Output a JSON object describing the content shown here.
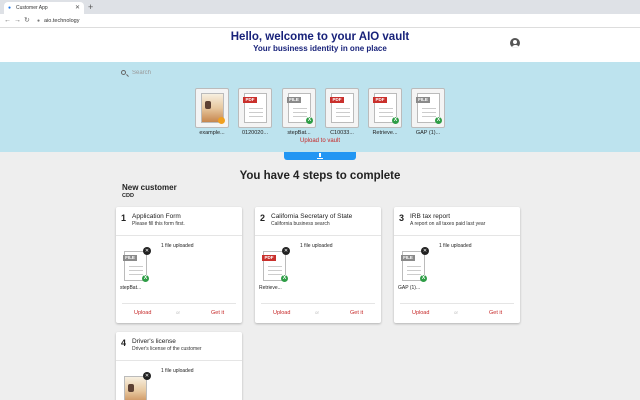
{
  "browser": {
    "tab_title": "Customer App",
    "url": "aio.technology"
  },
  "header": {
    "title": "Hello, welcome to your AIO vault",
    "subtitle": "Your business identity in one place"
  },
  "vault": {
    "search_placeholder": "Search",
    "files": [
      {
        "name": "example...",
        "type": "image"
      },
      {
        "name": "0120020...",
        "type": "pdf"
      },
      {
        "name": "stepBat...",
        "type": "file"
      },
      {
        "name": "C10033...",
        "type": "pdf"
      },
      {
        "name": "Retrieve...",
        "type": "pdf"
      },
      {
        "name": "GAP (1)...",
        "type": "file"
      }
    ],
    "upload_label": "Upload to vault"
  },
  "steps": {
    "title": "You have 4 steps to complete",
    "customer_name": "New customer",
    "customer_code": "CDD",
    "cards": [
      {
        "num": "1",
        "title": "Application Form",
        "desc": "Please fill this form first.",
        "status": "1 file uploaded",
        "file": "stepBat...",
        "file_type": "file",
        "upload": "Upload",
        "or": "or",
        "getit": "Get it"
      },
      {
        "num": "2",
        "title": "California Secretary of State",
        "desc": "California business search",
        "status": "1 file uploaded",
        "file": "Retrieve...",
        "file_type": "pdf",
        "upload": "Upload",
        "or": "or",
        "getit": "Get it"
      },
      {
        "num": "3",
        "title": "IRB tax report",
        "desc": "A report on all taxes paid last year",
        "status": "1 file uploaded",
        "file": "GAP (1)...",
        "file_type": "file",
        "upload": "Upload",
        "or": "or",
        "getit": "Get it"
      },
      {
        "num": "4",
        "title": "Driver's license",
        "desc": "Driver's license of the customer",
        "status": "1 file uploaded",
        "file_type": "image"
      }
    ]
  },
  "badges": {
    "pdf": "PDF",
    "file": "FILE",
    "xls": "X",
    "delete": "✕"
  },
  "colors": {
    "header_text": "#18227a",
    "vault_band": "#bde3ee",
    "accent_red": "#c62828",
    "upload_tab": "#2196f3"
  }
}
